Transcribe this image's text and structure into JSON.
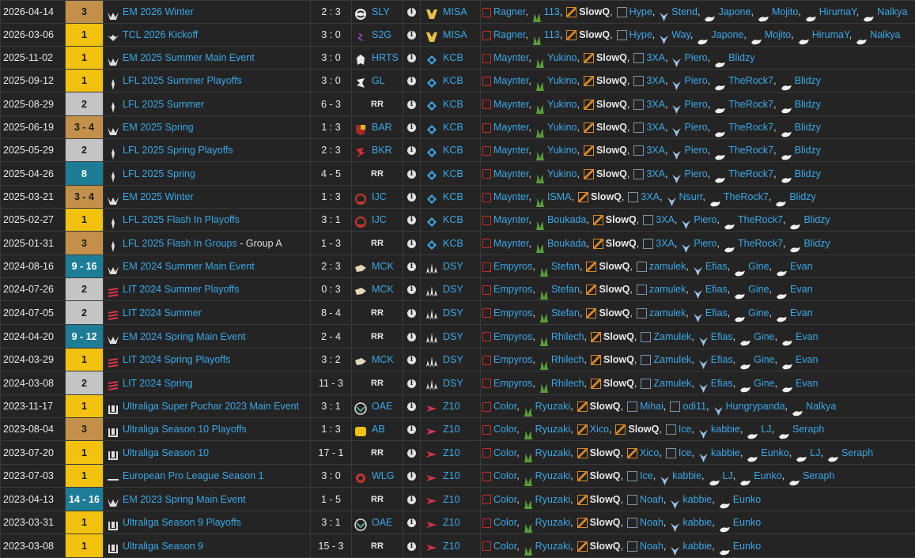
{
  "rows": [
    {
      "date": "2026-04-14",
      "place": "3",
      "pc": "p3",
      "event": "EM 2026 Winter",
      "sub": "",
      "ev_icon": "em",
      "score": "2 : 3",
      "opp": "SLY",
      "opp_icon": "sly",
      "team": "MISA",
      "team_icon": "misa",
      "roster": [
        [
          "top",
          "Ragner"
        ],
        [
          "jg",
          "113"
        ],
        [
          "mid",
          "SlowQ"
        ],
        [
          "bot",
          "Hype"
        ],
        [
          "sup",
          "Stend"
        ],
        [
          "coach",
          "Japone"
        ],
        [
          "coach",
          "Mojito"
        ],
        [
          "coach",
          "HirumaY"
        ],
        [
          "coach",
          "Nalkya"
        ]
      ]
    },
    {
      "date": "2026-03-06",
      "place": "1",
      "pc": "p1",
      "event": "TCL 2026 Kickoff",
      "sub": "",
      "ev_icon": "tcl",
      "score": "3 : 0",
      "opp": "S2G",
      "opp_icon": "s2g",
      "team": "MISA",
      "team_icon": "misa",
      "roster": [
        [
          "top",
          "Ragner"
        ],
        [
          "jg",
          "113"
        ],
        [
          "mid",
          "SlowQ"
        ],
        [
          "bot",
          "Hype"
        ],
        [
          "sup",
          "Way"
        ],
        [
          "coach",
          "Japone"
        ],
        [
          "coach",
          "Mojito"
        ],
        [
          "coach",
          "HirumaY"
        ],
        [
          "coach",
          "Nalkya"
        ]
      ]
    },
    {
      "date": "2025-11-02",
      "place": "1",
      "pc": "p1",
      "event": "EM 2025 Summer Main Event",
      "sub": "",
      "ev_icon": "em",
      "score": "3 : 0",
      "opp": "HRTS",
      "opp_icon": "hrts",
      "team": "KCB",
      "team_icon": "kcb",
      "roster": [
        [
          "top",
          "Maynter"
        ],
        [
          "jg",
          "Yukino"
        ],
        [
          "mid",
          "SlowQ"
        ],
        [
          "bot",
          "3XA"
        ],
        [
          "sup",
          "Piero"
        ],
        [
          "coach",
          "Blidzy"
        ]
      ]
    },
    {
      "date": "2025-09-12",
      "place": "1",
      "pc": "p1",
      "event": "LFL 2025 Summer Playoffs",
      "sub": "",
      "ev_icon": "lfl",
      "score": "3 : 0",
      "opp": "GL",
      "opp_icon": "gl",
      "team": "KCB",
      "team_icon": "kcb",
      "roster": [
        [
          "top",
          "Maynter"
        ],
        [
          "jg",
          "Yukino"
        ],
        [
          "mid",
          "SlowQ"
        ],
        [
          "bot",
          "3XA"
        ],
        [
          "sup",
          "Piero"
        ],
        [
          "coach",
          "TheRock7"
        ],
        [
          "coach",
          "Blidzy"
        ]
      ]
    },
    {
      "date": "2025-08-29",
      "place": "2",
      "pc": "p2",
      "event": "LFL 2025 Summer",
      "sub": "",
      "ev_icon": "lfl",
      "score": "6 - 3",
      "opp": "RR",
      "opp_icon": "",
      "team": "KCB",
      "team_icon": "kcb",
      "roster": [
        [
          "top",
          "Maynter"
        ],
        [
          "jg",
          "Yukino"
        ],
        [
          "mid",
          "SlowQ"
        ],
        [
          "bot",
          "3XA"
        ],
        [
          "sup",
          "Piero"
        ],
        [
          "coach",
          "TheRock7"
        ],
        [
          "coach",
          "Blidzy"
        ]
      ]
    },
    {
      "date": "2025-06-19",
      "place": "3 - 4",
      "pc": "p3",
      "event": "EM 2025 Spring",
      "sub": "",
      "ev_icon": "em",
      "score": "1 : 3",
      "opp": "BAR",
      "opp_icon": "bar",
      "team": "KCB",
      "team_icon": "kcb",
      "roster": [
        [
          "top",
          "Maynter"
        ],
        [
          "jg",
          "Yukino"
        ],
        [
          "mid",
          "SlowQ"
        ],
        [
          "bot",
          "3XA"
        ],
        [
          "sup",
          "Piero"
        ],
        [
          "coach",
          "TheRock7"
        ],
        [
          "coach",
          "Blidzy"
        ]
      ]
    },
    {
      "date": "2025-05-29",
      "place": "2",
      "pc": "p2",
      "event": "LFL 2025 Spring Playoffs",
      "sub": "",
      "ev_icon": "lfl",
      "score": "2 : 3",
      "opp": "BKR",
      "opp_icon": "bkr",
      "team": "KCB",
      "team_icon": "kcb",
      "roster": [
        [
          "top",
          "Maynter"
        ],
        [
          "jg",
          "Yukino"
        ],
        [
          "mid",
          "SlowQ"
        ],
        [
          "bot",
          "3XA"
        ],
        [
          "sup",
          "Piero"
        ],
        [
          "coach",
          "TheRock7"
        ],
        [
          "coach",
          "Blidzy"
        ]
      ]
    },
    {
      "date": "2025-04-26",
      "place": "8",
      "pc": "p8",
      "event": "LFL 2025 Spring",
      "sub": "",
      "ev_icon": "lfl",
      "score": "4 - 5",
      "opp": "RR",
      "opp_icon": "",
      "team": "KCB",
      "team_icon": "kcb",
      "roster": [
        [
          "top",
          "Maynter"
        ],
        [
          "jg",
          "Yukino"
        ],
        [
          "mid",
          "SlowQ"
        ],
        [
          "bot",
          "3XA"
        ],
        [
          "sup",
          "Piero"
        ],
        [
          "coach",
          "TheRock7"
        ],
        [
          "coach",
          "Blidzy"
        ]
      ]
    },
    {
      "date": "2025-03-21",
      "place": "3 - 4",
      "pc": "p3",
      "event": "EM 2025 Winter",
      "sub": "",
      "ev_icon": "em",
      "score": "1 : 3",
      "opp": "IJC",
      "opp_icon": "ijc",
      "team": "KCB",
      "team_icon": "kcb",
      "roster": [
        [
          "top",
          "Maynter"
        ],
        [
          "jg",
          "ISMA"
        ],
        [
          "mid",
          "SlowQ"
        ],
        [
          "bot",
          "3XA"
        ],
        [
          "sup",
          "Nsurr"
        ],
        [
          "coach",
          "TheRock7"
        ],
        [
          "coach",
          "Blidzy"
        ]
      ]
    },
    {
      "date": "2025-02-27",
      "place": "1",
      "pc": "p1",
      "event": "LFL 2025 Flash In Playoffs",
      "sub": "",
      "ev_icon": "lfl",
      "score": "3 : 1",
      "opp": "IJC",
      "opp_icon": "ijc",
      "team": "KCB",
      "team_icon": "kcb",
      "roster": [
        [
          "top",
          "Maynter"
        ],
        [
          "jg",
          "Boukada"
        ],
        [
          "mid",
          "SlowQ"
        ],
        [
          "bot",
          "3XA"
        ],
        [
          "sup",
          "Piero"
        ],
        [
          "coach",
          "TheRock7"
        ],
        [
          "coach",
          "Blidzy"
        ]
      ]
    },
    {
      "date": "2025-01-31",
      "place": "3",
      "pc": "p3",
      "event": "LFL 2025 Flash In Groups",
      "sub": " - Group A",
      "ev_icon": "lfl",
      "score": "1 - 3",
      "opp": "RR",
      "opp_icon": "",
      "team": "KCB",
      "team_icon": "kcb",
      "roster": [
        [
          "top",
          "Maynter"
        ],
        [
          "jg",
          "Boukada"
        ],
        [
          "mid",
          "SlowQ"
        ],
        [
          "bot",
          "3XA"
        ],
        [
          "sup",
          "Piero"
        ],
        [
          "coach",
          "TheRock7"
        ],
        [
          "coach",
          "Blidzy"
        ]
      ]
    },
    {
      "date": "2024-08-16",
      "place": "9 - 16",
      "pc": "pblue",
      "event": "EM 2024 Summer Main Event",
      "sub": "",
      "ev_icon": "em",
      "score": "2 : 3",
      "opp": "MCK",
      "opp_icon": "mck",
      "team": "DSY",
      "team_icon": "dsy",
      "roster": [
        [
          "top",
          "Empyros"
        ],
        [
          "jg",
          "Stefan"
        ],
        [
          "mid",
          "SlowQ"
        ],
        [
          "bot",
          "zamulek"
        ],
        [
          "sup",
          "Efias"
        ],
        [
          "coach",
          "Gine"
        ],
        [
          "coach",
          "Evan"
        ]
      ]
    },
    {
      "date": "2024-07-26",
      "place": "2",
      "pc": "p2",
      "event": "LIT 2024 Summer Playoffs",
      "sub": "",
      "ev_icon": "lit",
      "score": "0 : 3",
      "opp": "MCK",
      "opp_icon": "mck",
      "team": "DSY",
      "team_icon": "dsy",
      "roster": [
        [
          "top",
          "Empyros"
        ],
        [
          "jg",
          "Stefan"
        ],
        [
          "mid",
          "SlowQ"
        ],
        [
          "bot",
          "zamulek"
        ],
        [
          "sup",
          "Efias"
        ],
        [
          "coach",
          "Gine"
        ],
        [
          "coach",
          "Evan"
        ]
      ]
    },
    {
      "date": "2024-07-05",
      "place": "2",
      "pc": "p2",
      "event": "LIT 2024 Summer",
      "sub": "",
      "ev_icon": "lit",
      "score": "8 - 4",
      "opp": "RR",
      "opp_icon": "",
      "team": "DSY",
      "team_icon": "dsy",
      "roster": [
        [
          "top",
          "Empyros"
        ],
        [
          "jg",
          "Stefan"
        ],
        [
          "mid",
          "SlowQ"
        ],
        [
          "bot",
          "zamulek"
        ],
        [
          "sup",
          "Efias"
        ],
        [
          "coach",
          "Gine"
        ],
        [
          "coach",
          "Evan"
        ]
      ]
    },
    {
      "date": "2024-04-20",
      "place": "9 - 12",
      "pc": "pblue",
      "event": "EM 2024 Spring Main Event",
      "sub": "",
      "ev_icon": "em",
      "score": "2 - 4",
      "opp": "RR",
      "opp_icon": "",
      "team": "DSY",
      "team_icon": "dsy",
      "roster": [
        [
          "top",
          "Empyros"
        ],
        [
          "jg",
          "Rhilech"
        ],
        [
          "mid",
          "SlowQ"
        ],
        [
          "bot",
          "Zamulek"
        ],
        [
          "sup",
          "Efias"
        ],
        [
          "coach",
          "Gine"
        ],
        [
          "coach",
          "Evan"
        ]
      ]
    },
    {
      "date": "2024-03-29",
      "place": "1",
      "pc": "p1",
      "event": "LIT 2024 Spring Playoffs",
      "sub": "",
      "ev_icon": "lit",
      "score": "3 : 2",
      "opp": "MCK",
      "opp_icon": "mck",
      "team": "DSY",
      "team_icon": "dsy",
      "roster": [
        [
          "top",
          "Empyros"
        ],
        [
          "jg",
          "Rhilech"
        ],
        [
          "mid",
          "SlowQ"
        ],
        [
          "bot",
          "Zamulek"
        ],
        [
          "sup",
          "Efias"
        ],
        [
          "coach",
          "Gine"
        ],
        [
          "coach",
          "Evan"
        ]
      ]
    },
    {
      "date": "2024-03-08",
      "place": "2",
      "pc": "p2",
      "event": "LIT 2024 Spring",
      "sub": "",
      "ev_icon": "lit",
      "score": "11 - 3",
      "opp": "RR",
      "opp_icon": "",
      "team": "DSY",
      "team_icon": "dsy",
      "roster": [
        [
          "top",
          "Empyros"
        ],
        [
          "jg",
          "Rhilech"
        ],
        [
          "mid",
          "SlowQ"
        ],
        [
          "bot",
          "Zamulek"
        ],
        [
          "sup",
          "Efias"
        ],
        [
          "coach",
          "Gine"
        ],
        [
          "coach",
          "Evan"
        ]
      ]
    },
    {
      "date": "2023-11-17",
      "place": "1",
      "pc": "p1",
      "event": "Ultraliga Super Puchar 2023 Main Event",
      "sub": "",
      "ev_icon": "ul",
      "score": "3 : 1",
      "opp": "OAE",
      "opp_icon": "oae",
      "team": "Z10",
      "team_icon": "z10",
      "roster": [
        [
          "top",
          "Color"
        ],
        [
          "jg",
          "Ryuzaki"
        ],
        [
          "mid",
          "SlowQ"
        ],
        [
          "bot",
          "Mihai"
        ],
        [
          "botn",
          "odi11"
        ],
        [
          "sup",
          "Hungrypanda"
        ],
        [
          "coach",
          "Nalkya"
        ]
      ]
    },
    {
      "date": "2023-08-04",
      "place": "3",
      "pc": "p3",
      "event": "Ultraliga Season 10 Playoffs",
      "sub": "",
      "ev_icon": "ul",
      "score": "1 : 3",
      "opp": "AB",
      "opp_icon": "ab",
      "team": "Z10",
      "team_icon": "z10",
      "roster": [
        [
          "top",
          "Color"
        ],
        [
          "jg",
          "Ryuzaki"
        ],
        [
          "mid",
          "Xico"
        ],
        [
          "mid",
          "SlowQ"
        ],
        [
          "bot",
          "Ice"
        ],
        [
          "sup",
          "kabbie"
        ],
        [
          "coach",
          "LJ"
        ],
        [
          "coach",
          "Seraph"
        ]
      ]
    },
    {
      "date": "2023-07-20",
      "place": "1",
      "pc": "p1",
      "event": "Ultraliga Season 10",
      "sub": "",
      "ev_icon": "ul",
      "score": "17 - 1",
      "opp": "RR",
      "opp_icon": "",
      "team": "Z10",
      "team_icon": "z10",
      "roster": [
        [
          "top",
          "Color"
        ],
        [
          "jg",
          "Ryuzaki"
        ],
        [
          "mid",
          "SlowQ"
        ],
        [
          "mid",
          "Xico"
        ],
        [
          "bot",
          "Ice"
        ],
        [
          "sup",
          "kabbie"
        ],
        [
          "coach",
          "Eunko"
        ],
        [
          "coach",
          "LJ"
        ],
        [
          "coach",
          "Seraph"
        ]
      ]
    },
    {
      "date": "2023-07-03",
      "place": "1",
      "pc": "p1",
      "event": "European Pro League Season 1",
      "sub": "",
      "ev_icon": "epl",
      "score": "3 : 0",
      "opp": "WLG",
      "opp_icon": "wlg",
      "team": "Z10",
      "team_icon": "z10",
      "roster": [
        [
          "top",
          "Color"
        ],
        [
          "jg",
          "Ryuzaki"
        ],
        [
          "mid",
          "SlowQ"
        ],
        [
          "bot",
          "Ice"
        ],
        [
          "sup",
          "kabbie"
        ],
        [
          "coach",
          "LJ"
        ],
        [
          "coach",
          "Eunko"
        ],
        [
          "coach",
          "Seraph"
        ]
      ]
    },
    {
      "date": "2023-04-13",
      "place": "14 - 16",
      "pc": "pblue",
      "event": "EM 2023 Spring Main Event",
      "sub": "",
      "ev_icon": "em",
      "score": "1 - 5",
      "opp": "RR",
      "opp_icon": "",
      "team": "Z10",
      "team_icon": "z10",
      "roster": [
        [
          "top",
          "Color"
        ],
        [
          "jg",
          "Ryuzaki"
        ],
        [
          "mid",
          "SlowQ"
        ],
        [
          "bot",
          "Noah"
        ],
        [
          "sup",
          "kabbie"
        ],
        [
          "coach",
          "Eunko"
        ]
      ]
    },
    {
      "date": "2023-03-31",
      "place": "1",
      "pc": "p1",
      "event": "Ultraliga Season 9 Playoffs",
      "sub": "",
      "ev_icon": "ul",
      "score": "3 : 1",
      "opp": "OAE",
      "opp_icon": "oae",
      "team": "Z10",
      "team_icon": "z10",
      "roster": [
        [
          "top",
          "Color"
        ],
        [
          "jg",
          "Ryuzaki"
        ],
        [
          "mid",
          "SlowQ"
        ],
        [
          "bot",
          "Noah"
        ],
        [
          "sup",
          "kabbie"
        ],
        [
          "coach",
          "Eunko"
        ]
      ]
    },
    {
      "date": "2023-03-08",
      "place": "1",
      "pc": "p1",
      "event": "Ultraliga Season 9",
      "sub": "",
      "ev_icon": "ul",
      "score": "15 - 3",
      "opp": "RR",
      "opp_icon": "",
      "team": "Z10",
      "team_icon": "z10",
      "roster": [
        [
          "top",
          "Color"
        ],
        [
          "jg",
          "Ryuzaki"
        ],
        [
          "mid",
          "SlowQ"
        ],
        [
          "bot",
          "Noah"
        ],
        [
          "sup",
          "kabbie"
        ],
        [
          "coach",
          "Eunko"
        ]
      ]
    }
  ],
  "highlight_player": "SlowQ",
  "info_glyph": "i",
  "colors": {
    "link": "#3ba8e6",
    "gold": "#f2c20f",
    "silver": "#c4c4c4",
    "bronze": "#c3904a",
    "teal": "#1d7d97",
    "bg": "#242424"
  }
}
